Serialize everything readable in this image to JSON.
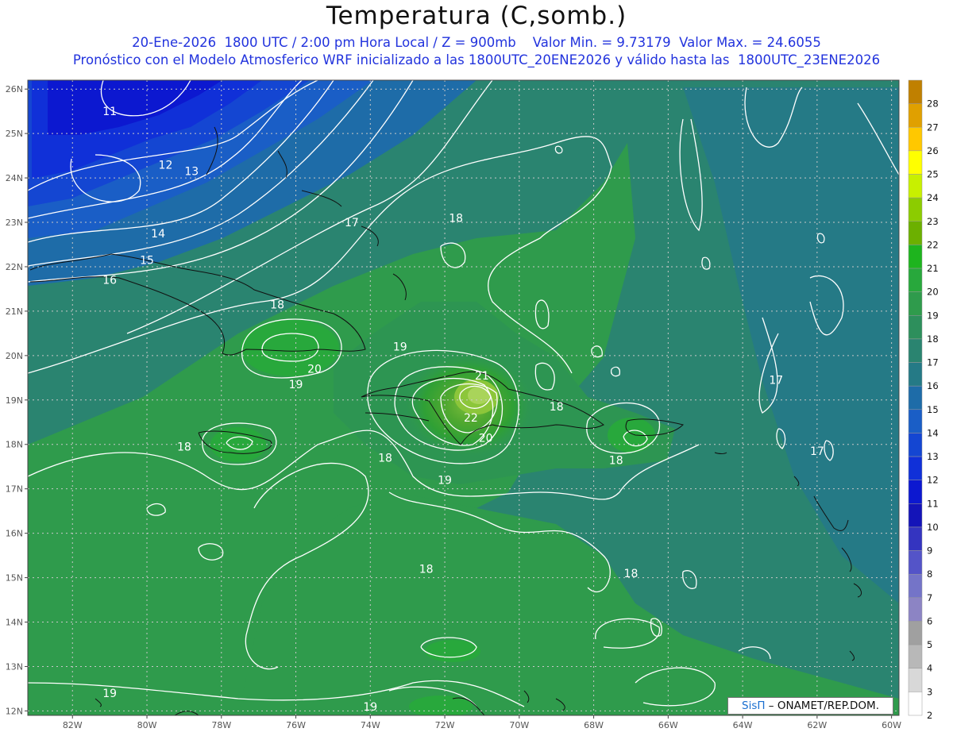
{
  "header": {
    "title": "Temperatura (C,somb.)",
    "subtitle_line1": "20-Ene-2026  1800 UTC / 2:00 pm Hora Local / Z = 900mb    Valor Min. = 9.73179  Valor Max. = 24.6055",
    "subtitle_line2": "Pronóstico con el Modelo Atmosferico WRF inicializado a las 1800UTC_20ENE2026 y válido hasta las  1800UTC_23ENE2026"
  },
  "map": {
    "lat_labels": [
      "26N",
      "25N",
      "24N",
      "23N",
      "22N",
      "21N",
      "20N",
      "19N",
      "18N",
      "17N",
      "16N",
      "15N",
      "14N",
      "13N",
      "12N"
    ],
    "lon_labels": [
      "82W",
      "80W",
      "78W",
      "76W",
      "74W",
      "72W",
      "70W",
      "68W",
      "66W",
      "64W",
      "62W",
      "60W"
    ],
    "contour_labels": [
      {
        "text": "11",
        "lon": -81.0,
        "lat": 25.5
      },
      {
        "text": "12",
        "lon": -79.5,
        "lat": 24.3
      },
      {
        "text": "13",
        "lon": -78.8,
        "lat": 24.15
      },
      {
        "text": "14",
        "lon": -79.7,
        "lat": 22.75
      },
      {
        "text": "15",
        "lon": -80.0,
        "lat": 22.15
      },
      {
        "text": "16",
        "lon": -81.0,
        "lat": 21.7
      },
      {
        "text": "17",
        "lon": -74.5,
        "lat": 23.0
      },
      {
        "text": "18",
        "lon": -71.7,
        "lat": 23.1
      },
      {
        "text": "18",
        "lon": -76.5,
        "lat": 21.15
      },
      {
        "text": "19",
        "lon": -73.2,
        "lat": 20.2
      },
      {
        "text": "20",
        "lon": -75.5,
        "lat": 19.7
      },
      {
        "text": "19",
        "lon": -76.0,
        "lat": 19.35
      },
      {
        "text": "21",
        "lon": -71.0,
        "lat": 19.55
      },
      {
        "text": "18",
        "lon": -69.0,
        "lat": 18.85
      },
      {
        "text": "22",
        "lon": -71.3,
        "lat": 18.6
      },
      {
        "text": "20",
        "lon": -70.9,
        "lat": 18.15
      },
      {
        "text": "18",
        "lon": -79.0,
        "lat": 17.95
      },
      {
        "text": "18",
        "lon": -73.6,
        "lat": 17.7
      },
      {
        "text": "18",
        "lon": -67.4,
        "lat": 17.65
      },
      {
        "text": "19",
        "lon": -72.0,
        "lat": 17.2
      },
      {
        "text": "18",
        "lon": -72.5,
        "lat": 15.2
      },
      {
        "text": "18",
        "lon": -67.0,
        "lat": 15.1
      },
      {
        "text": "17",
        "lon": -63.1,
        "lat": 19.45
      },
      {
        "text": "17",
        "lon": -62.0,
        "lat": 17.85
      },
      {
        "text": "19",
        "lon": -81.0,
        "lat": 12.4
      },
      {
        "text": "19",
        "lon": -74.0,
        "lat": 12.1
      }
    ],
    "colorbar": {
      "labels": [
        "28",
        "27",
        "26",
        "25",
        "24",
        "23",
        "22",
        "21",
        "20",
        "19",
        "18",
        "17",
        "16",
        "15",
        "14",
        "13",
        "12",
        "11",
        "10",
        "9",
        "8",
        "7",
        "6",
        "5",
        "4",
        "3",
        "2"
      ],
      "colors": [
        "#c08000",
        "#e0a000",
        "#ffc800",
        "#ffff00",
        "#c8f000",
        "#8ccc00",
        "#6cb000",
        "#1eb41e",
        "#28a83c",
        "#2f9b4c",
        "#2d8f5c",
        "#2a8470",
        "#257a86",
        "#1e6ca8",
        "#1a5ec6",
        "#1446d2",
        "#1030d8",
        "#0c18d0",
        "#1414b8",
        "#3434c0",
        "#5454c8",
        "#7474c8",
        "#8c84c4",
        "#a0a0a0",
        "#b8b8b8",
        "#d8d8d8",
        "#ffffff"
      ]
    }
  },
  "footer": {
    "credit_brand": "SisΠ",
    "credit_text": " – ONAMET/REP.DOM."
  }
}
